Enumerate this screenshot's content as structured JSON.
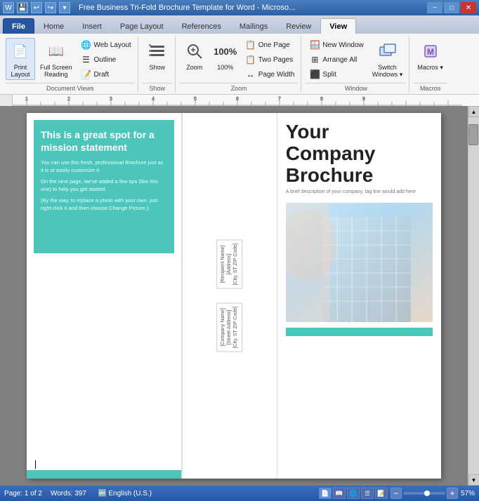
{
  "titleBar": {
    "title": "Free Business Tri-Fold Brochure Template for Word - Microsо...",
    "winBtns": [
      "−",
      "□",
      "✕"
    ]
  },
  "tabs": [
    {
      "id": "file",
      "label": "File",
      "active": false,
      "isFile": true
    },
    {
      "id": "home",
      "label": "Home",
      "active": false
    },
    {
      "id": "insert",
      "label": "Insert",
      "active": false
    },
    {
      "id": "pagelayout",
      "label": "Page Layout",
      "active": false
    },
    {
      "id": "references",
      "label": "References",
      "active": false
    },
    {
      "id": "mailings",
      "label": "Mailings",
      "active": false
    },
    {
      "id": "review",
      "label": "Review",
      "active": false
    },
    {
      "id": "view",
      "label": "View",
      "active": true
    }
  ],
  "ribbon": {
    "groups": [
      {
        "id": "document-views",
        "label": "Document Views",
        "items": [
          {
            "id": "print-layout",
            "label": "Print\nLayout",
            "icon": "📄",
            "active": true
          },
          {
            "id": "full-screen",
            "label": "Full Screen\nReading",
            "icon": "📖",
            "active": false
          },
          {
            "id": "web-layout",
            "label": "Web Layout",
            "small": true,
            "icon": "🌐"
          },
          {
            "id": "outline",
            "label": "Outline",
            "small": true,
            "icon": "☰"
          },
          {
            "id": "draft",
            "label": "Draft",
            "small": true,
            "icon": "📝"
          }
        ]
      },
      {
        "id": "show",
        "label": "Show",
        "items": [
          {
            "id": "show-btn",
            "label": "Show",
            "icon": "👁",
            "active": false
          }
        ]
      },
      {
        "id": "zoom-group",
        "label": "Zoom",
        "items": [
          {
            "id": "zoom-btn",
            "label": "Zoom",
            "icon": "🔍",
            "active": false
          },
          {
            "id": "zoom-100",
            "label": "100%",
            "active": false
          },
          {
            "id": "one-page",
            "label": "One\nPage",
            "small": true
          },
          {
            "id": "two-pages",
            "label": "Two\nPages",
            "small": true
          },
          {
            "id": "page-width",
            "label": "Page\nWidth",
            "small": true
          }
        ]
      },
      {
        "id": "window",
        "label": "Window",
        "items": [
          {
            "id": "new-window",
            "label": "New Window",
            "small": true
          },
          {
            "id": "arrange-all",
            "label": "Arrange All",
            "small": true
          },
          {
            "id": "split",
            "label": "Split",
            "small": true
          },
          {
            "id": "switch-windows",
            "label": "Switch\nWindows",
            "icon": "🪟"
          }
        ]
      },
      {
        "id": "macros",
        "label": "Macros",
        "items": [
          {
            "id": "macros-btn",
            "label": "Macros",
            "icon": "⚙"
          }
        ]
      }
    ]
  },
  "document": {
    "panels": {
      "left": {
        "heading": "This is a great spot for a mission statement",
        "paragraphs": [
          "You can use this fresh, professional Brochure just as it is or easily customize it.",
          "On the next page, we've added a few tips (like this one) to help you get started.",
          "{By the way, to replace a photo with your own, just right-click it and then choose Change Picture.}"
        ]
      },
      "middle": {
        "verticalTexts": [
          "[Recipient Name]\n[Address]\n[City, ST ZIP Code]",
          "[Company Name]\n[Street Address]\n[City, ST ZIP Code]"
        ]
      },
      "right": {
        "companyTitle": "Your\nCompany\nBrochure",
        "subtitle": "A brief description of your company, tag line would add here"
      }
    }
  },
  "statusBar": {
    "page": "Page: 1 of 2",
    "words": "Words: 397",
    "lang": "English (U.S.)",
    "zoom": "57%"
  }
}
